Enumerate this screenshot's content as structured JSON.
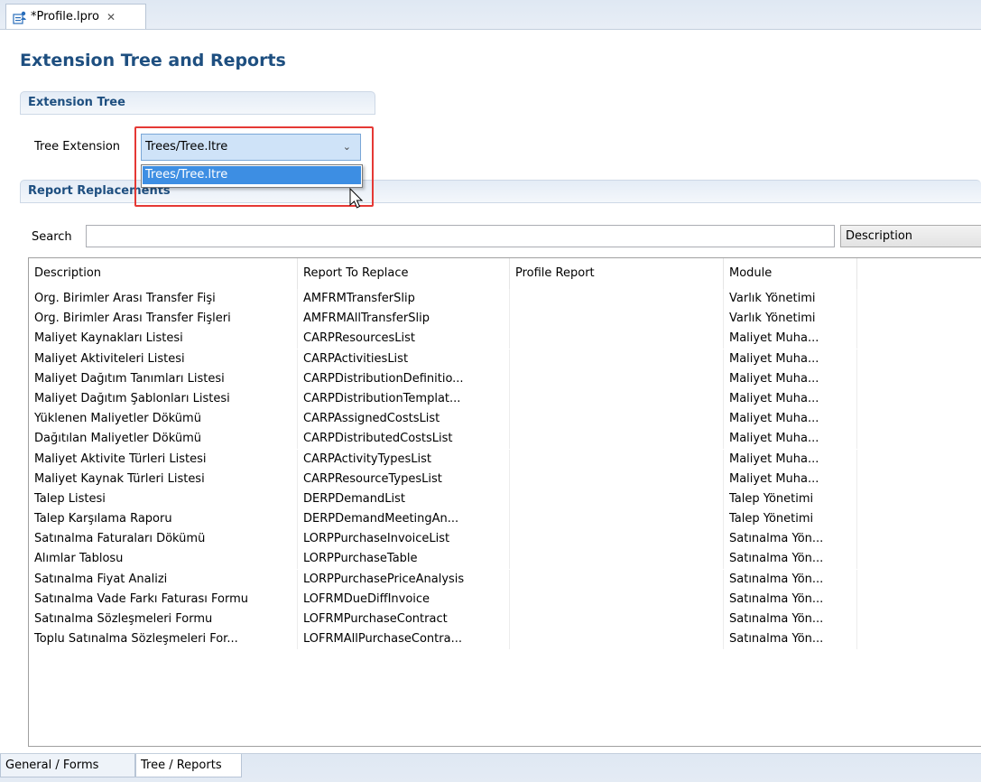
{
  "editor_tab": {
    "title": "*Profile.lpro",
    "close": "✕"
  },
  "form_title": "Extension Tree and Reports",
  "extension_tree": {
    "header": "Extension Tree",
    "tree_label": "Tree Extension",
    "selected_value": "Trees/Tree.ltre",
    "dropdown_options": [
      "Trees/Tree.ltre"
    ]
  },
  "report_replacements": {
    "header": "Report Replacements",
    "search_label": "Search",
    "search_value": "",
    "search_by": "Description",
    "columns": [
      "Description",
      "Report To Replace",
      "Profile Report",
      "Module",
      ""
    ],
    "rows": [
      [
        "Org. Birimler Arası Transfer Fişi",
        "AMFRMTransferSlip",
        "",
        "Varlık Yönetimi"
      ],
      [
        "Org. Birimler Arası Transfer Fişleri",
        "AMFRMAllTransferSlip",
        "",
        "Varlık Yönetimi"
      ],
      [
        "Maliyet Kaynakları Listesi",
        "CARPResourcesList",
        "",
        "Maliyet Muha..."
      ],
      [
        "Maliyet Aktiviteleri Listesi",
        "CARPActivitiesList",
        "",
        "Maliyet Muha..."
      ],
      [
        "Maliyet Dağıtım Tanımları Listesi",
        "CARPDistributionDefinitio...",
        "",
        "Maliyet Muha..."
      ],
      [
        "Maliyet Dağıtım Şablonları Listesi",
        "CARPDistributionTemplat...",
        "",
        "Maliyet Muha..."
      ],
      [
        "Yüklenen Maliyetler Dökümü",
        "CARPAssignedCostsList",
        "",
        "Maliyet Muha..."
      ],
      [
        "Dağıtılan Maliyetler Dökümü",
        "CARPDistributedCostsList",
        "",
        "Maliyet Muha..."
      ],
      [
        "Maliyet Aktivite Türleri Listesi",
        "CARPActivityTypesList",
        "",
        "Maliyet Muha..."
      ],
      [
        "Maliyet Kaynak Türleri Listesi",
        "CARPResourceTypesList",
        "",
        "Maliyet Muha..."
      ],
      [
        "Talep Listesi",
        "DERPDemandList",
        "",
        "Talep Yönetimi"
      ],
      [
        "Talep Karşılama Raporu",
        "DERPDemandMeetingAn...",
        "",
        "Talep Yönetimi"
      ],
      [
        "Satınalma Faturaları Dökümü",
        "LORPPurchaseInvoiceList",
        "",
        "Satınalma Yön..."
      ],
      [
        "Alımlar Tablosu",
        "LORPPurchaseTable",
        "",
        "Satınalma Yön..."
      ],
      [
        "Satınalma Fiyat Analizi",
        "LORPPurchasePriceAnalysis",
        "",
        "Satınalma Yön..."
      ],
      [
        "Satınalma Vade Farkı Faturası Formu",
        "LOFRMDueDiffInvoice",
        "",
        "Satınalma Yön..."
      ],
      [
        "Satınalma Sözleşmeleri Formu",
        "LOFRMPurchaseContract",
        "",
        "Satınalma Yön..."
      ],
      [
        "Toplu Satınalma Sözleşmeleri For...",
        "LOFRMAllPurchaseContra...",
        "",
        "Satınalma Yön..."
      ]
    ]
  },
  "bottom_tabs": [
    {
      "label": "General / Forms",
      "active": false
    },
    {
      "label": "Tree / Reports",
      "active": true
    }
  ],
  "colors": {
    "title_blue": "#1e4f80",
    "selection_blue": "#3d8ee3",
    "highlight_red": "#e53935"
  }
}
